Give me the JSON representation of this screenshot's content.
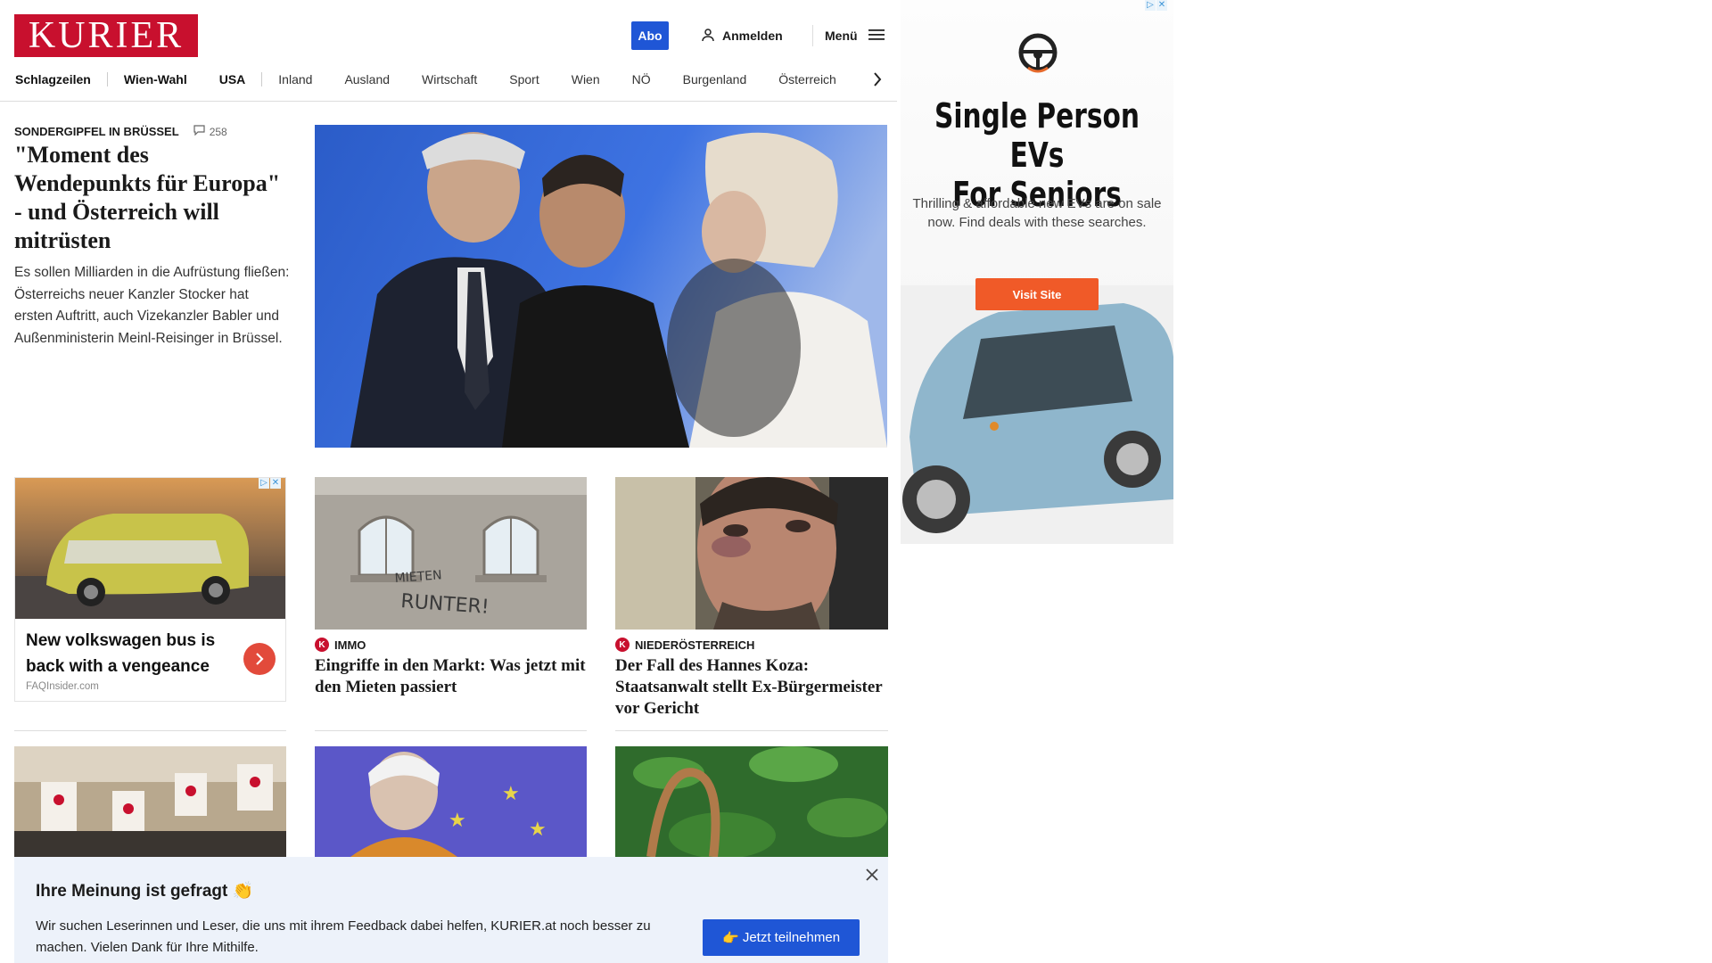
{
  "header": {
    "logo": "KURIER",
    "abo_label": "Abo",
    "login_label": "Anmelden",
    "menu_label": "Menü"
  },
  "nav": {
    "items": [
      "Schlagzeilen",
      "Wien-Wahl",
      "USA",
      "Inland",
      "Ausland",
      "Wirtschaft",
      "Sport",
      "Wien",
      "NÖ",
      "Burgenland",
      "Österreich"
    ]
  },
  "lead": {
    "kicker": "SONDERGIPFEL IN BRÜSSEL",
    "comments": "258",
    "title": "\"Moment des Wendepunkts für Europa\" - und Österreich will mitrüsten",
    "teaser": "Es sollen Milliarden in die Aufrüstung fließen: Österreichs neuer Kanzler Stocker hat ersten Auftritt, auch Vizekanzler Babler und Außenministerin Meinl-Reisinger in Brüssel."
  },
  "native_ad": {
    "title": "New volkswagen bus is back with a vengeance",
    "source": "FAQInsider.com"
  },
  "cards": [
    {
      "kicker": "IMMO",
      "title": "Eingriffe in den Markt: Was jetzt mit den Mieten passiert",
      "graffiti_1": "MIETEN",
      "graffiti_2": "RUNTER!"
    },
    {
      "kicker": "NIEDERÖSTERREICH",
      "title": "Der Fall des Hannes Koza: Staatsanwalt stellt Ex-Bürgermeister vor Gericht"
    }
  ],
  "side_ad": {
    "headline_1": "Single Person EVs",
    "headline_2": "For Seniors",
    "subtext": "Thrilling & affordable new EVs are on sale now. Find deals with these searches.",
    "cta": "Visit Site"
  },
  "survey": {
    "title": "Ihre Meinung ist gefragt",
    "title_emoji": "👏",
    "text": "Wir suchen Leserinnen und Leser, die uns mit ihrem Feedback dabei helfen, KURIER.at noch besser zu machen. Vielen Dank für Ihre Mithilfe.",
    "button_emoji": "👉",
    "button_label": "Jetzt teilnehmen"
  },
  "colors": {
    "brand": "#c8102e",
    "primary": "#1f56d6",
    "survey_bg": "#edf2fa",
    "ad_cta": "#f05a28"
  }
}
